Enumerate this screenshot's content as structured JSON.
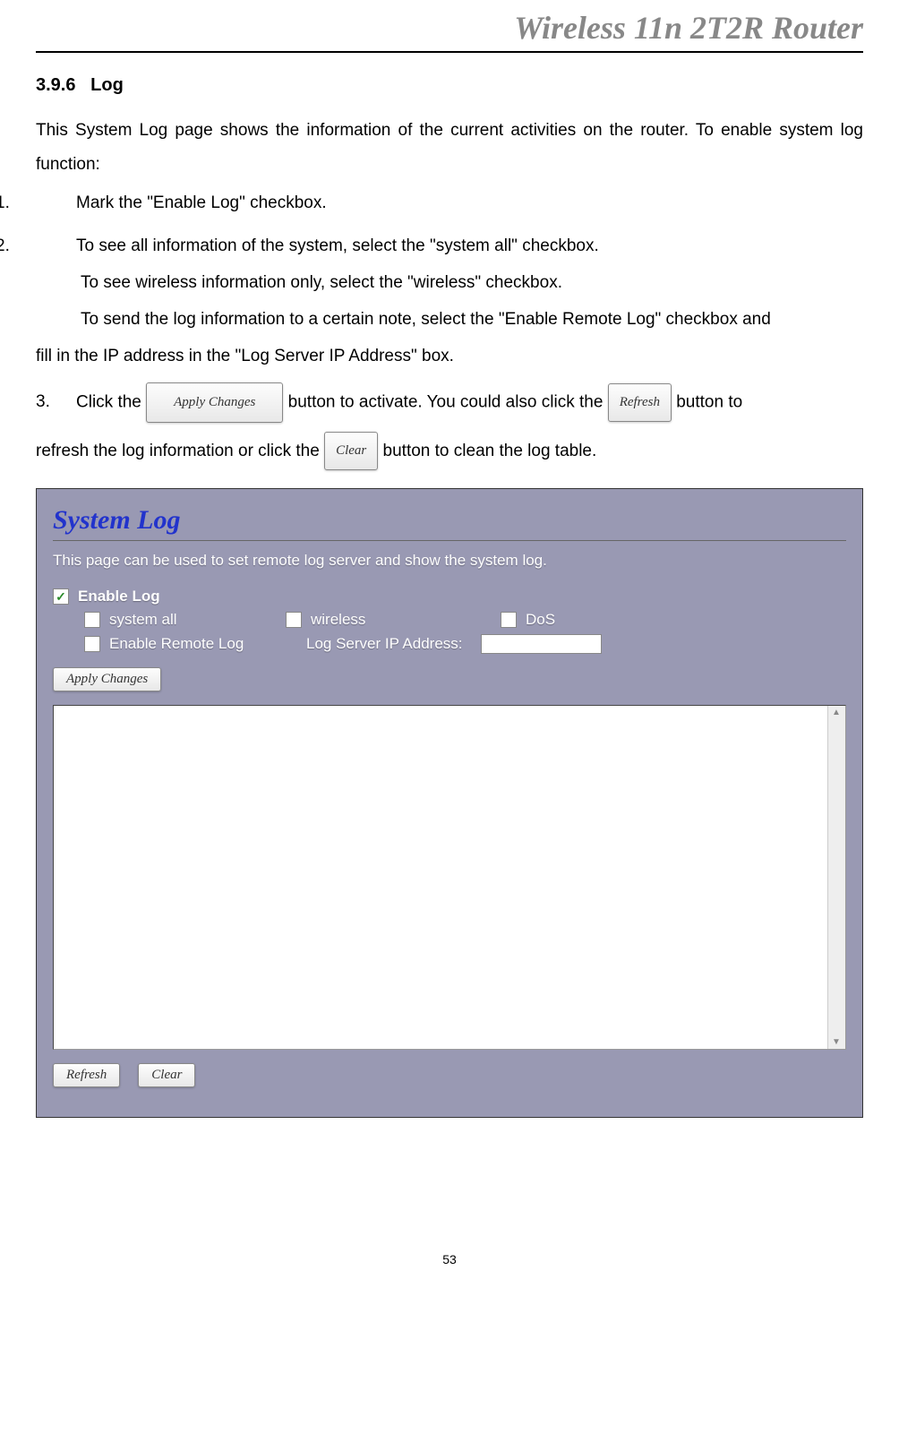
{
  "header": {
    "title": "Wireless 11n 2T2R Router"
  },
  "section": {
    "number": "3.9.6",
    "title": "Log"
  },
  "intro": "This System Log page shows the information of the current activities on the router. To enable system log function:",
  "steps": {
    "1": {
      "prefix": "1.",
      "text": "Mark the \"Enable Log\" checkbox."
    },
    "2": {
      "prefix": "2.",
      "text": "To see all information of the system, select the \"system all\" checkbox.",
      "sub1": "To see wireless information only, select the \"wireless\" checkbox.",
      "sub2_part1": "To send the log information to a certain note, select the \"Enable Remote Log\" checkbox and",
      "sub2_part2": "fill in the IP address in the \"Log Server IP Address\" box."
    },
    "3": {
      "prefix": "3.",
      "text_a": "Click the ",
      "btn_apply": "Apply Changes",
      "text_b": " button to activate. You could also click the ",
      "btn_refresh": "Refresh",
      "text_c": " button to",
      "text_d": "refresh the log information or click the ",
      "btn_clear": "Clear",
      "text_e": " button to clean the log table."
    }
  },
  "panel": {
    "title": "System Log",
    "desc": "This page can be used to set remote log server and show the system log.",
    "enable_log": "Enable Log",
    "opt_system_all": "system all",
    "opt_wireless": "wireless",
    "opt_dos": "DoS",
    "enable_remote": "Enable Remote Log",
    "log_server_label": "Log Server IP Address:",
    "btn_apply": "Apply Changes",
    "btn_refresh": "Refresh",
    "btn_clear": "Clear"
  },
  "page_number": "53"
}
